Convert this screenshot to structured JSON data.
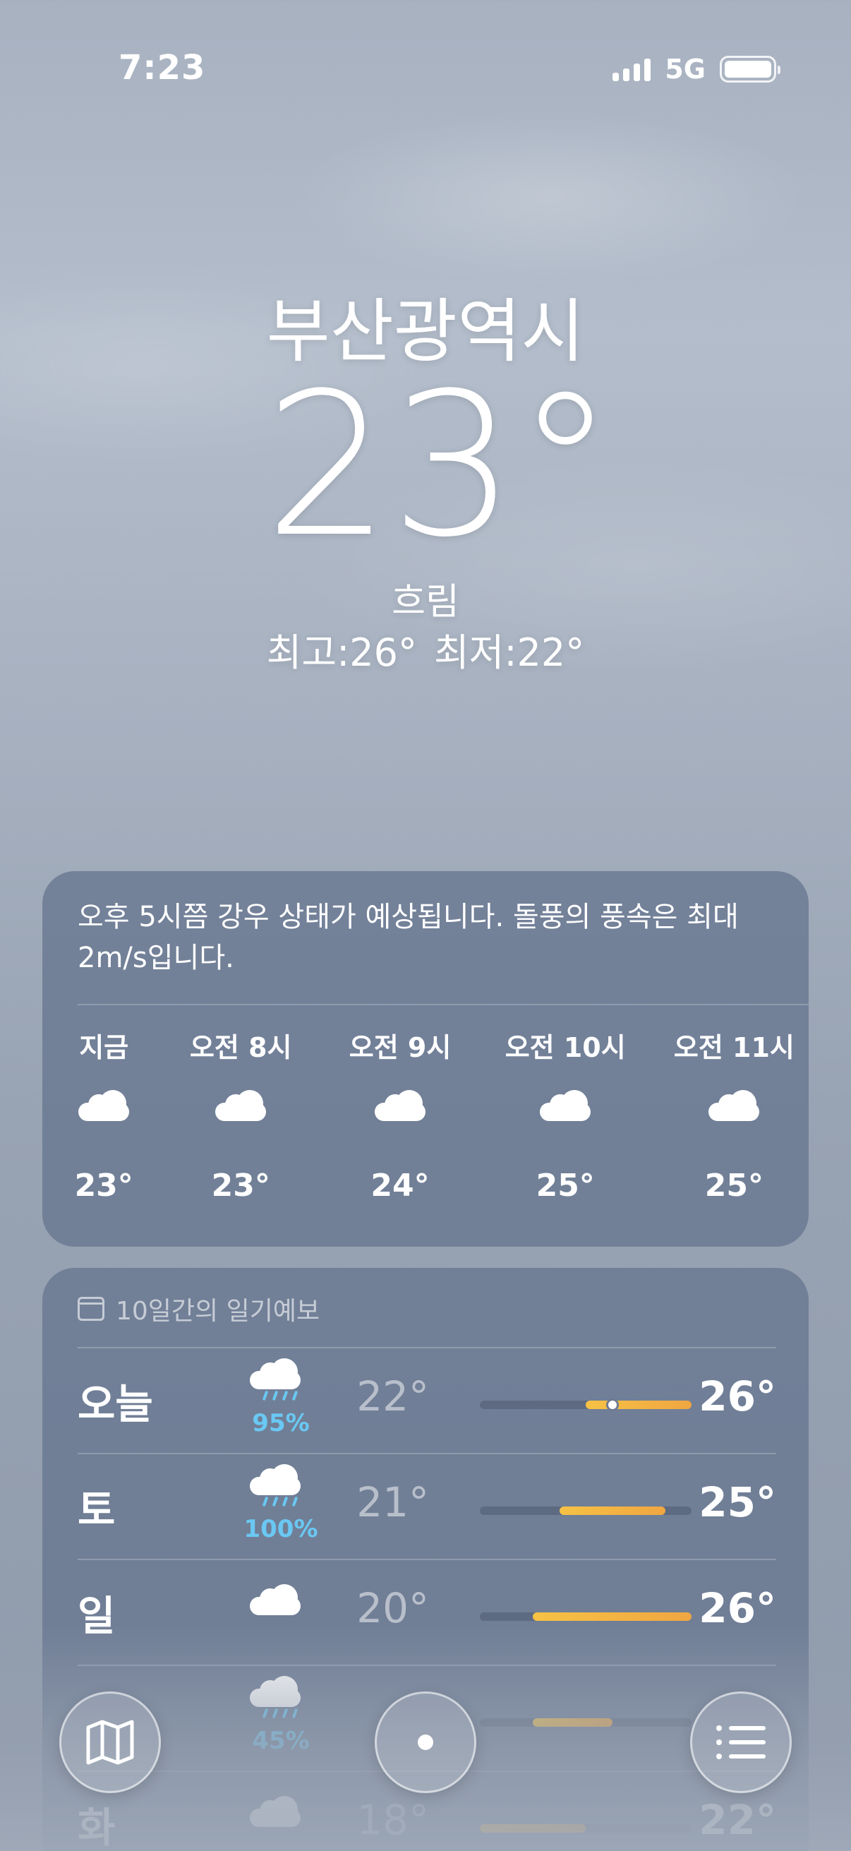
{
  "status": {
    "time": "7:23",
    "network": "5G"
  },
  "header": {
    "city": "부산광역시",
    "temperature": "23°",
    "condition": "흐림",
    "high": "최고:26°",
    "low": "최저:22°"
  },
  "hourly": {
    "summary": "오후 5시쯤 강우 상태가 예상됩니다. 돌풍의 풍속은 최대 2m/s입니다.",
    "items": [
      {
        "label": "지금",
        "icon": "cloud-icon",
        "temp": "23°"
      },
      {
        "label": "오전 8시",
        "icon": "cloud-icon",
        "temp": "23°"
      },
      {
        "label": "오전 9시",
        "icon": "cloud-icon",
        "temp": "24°"
      },
      {
        "label": "오전 10시",
        "icon": "cloud-icon",
        "temp": "25°"
      },
      {
        "label": "오전 11시",
        "icon": "cloud-icon",
        "temp": "25°"
      }
    ]
  },
  "daily": {
    "title": "10일간의 일기예보",
    "range": [
      18,
      26
    ],
    "current_temp": 23,
    "items": [
      {
        "day": "오늘",
        "icon": "cloud-rain-icon",
        "precip": "95%",
        "low": "22°",
        "high": "26°",
        "low_val": 22,
        "high_val": 26
      },
      {
        "day": "토",
        "icon": "cloud-rain-icon",
        "precip": "100%",
        "low": "21°",
        "high": "25°",
        "low_val": 21,
        "high_val": 25
      },
      {
        "day": "일",
        "icon": "cloud-icon",
        "precip": "",
        "low": "20°",
        "high": "26°",
        "low_val": 20,
        "high_val": 26
      },
      {
        "day": "",
        "icon": "cloud-rain-icon",
        "precip": "45%",
        "low": "",
        "high": "",
        "low_val": 20,
        "high_val": 23
      },
      {
        "day": "화",
        "icon": "cloud-icon",
        "precip": "",
        "low": "18°",
        "high": "22°",
        "low_val": 18,
        "high_val": 22
      }
    ]
  },
  "toolbar": {
    "map_icon": "map-icon",
    "location_icon": "location-icon",
    "list_icon": "list-icon"
  }
}
